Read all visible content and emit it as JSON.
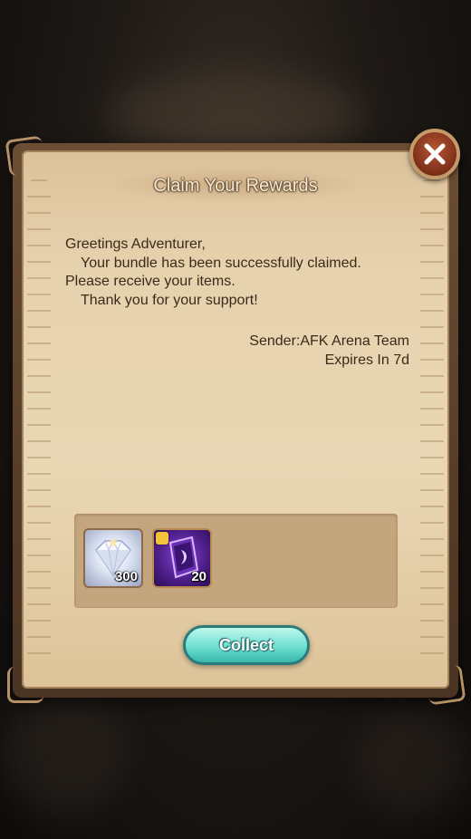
{
  "dialog": {
    "title": "Claim Your Rewards",
    "message_lines": [
      "Greetings Adventurer,",
      "Your bundle has been successfully claimed.",
      "Please receive your items.",
      "Thank you for your support!"
    ],
    "sender": "Sender:AFK Arena Team",
    "expires": "Expires In 7d"
  },
  "items": [
    {
      "icon": "diamond-icon",
      "count": "300"
    },
    {
      "icon": "purple-card-icon",
      "count": "20"
    }
  ],
  "buttons": {
    "collect_label": "Collect",
    "close_icon": "close-icon"
  },
  "colors": {
    "accent": "#6fe0d2",
    "close": "#7d2e18",
    "parchment": "#e9d7b4"
  }
}
